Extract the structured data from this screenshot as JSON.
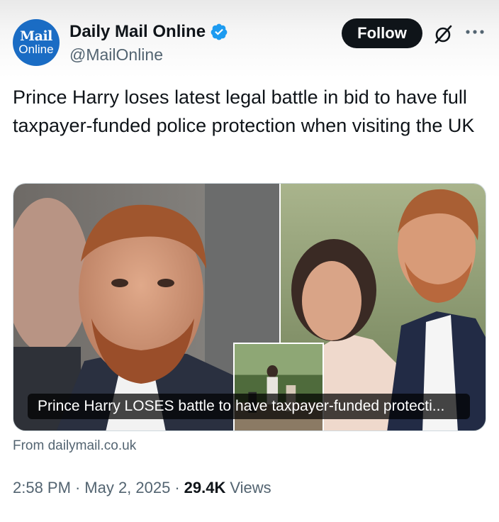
{
  "account": {
    "avatar_line1": "Mail",
    "avatar_line2": "Online",
    "display_name": "Daily Mail Online",
    "handle": "@MailOnline",
    "verified_icon": "verified-badge-icon"
  },
  "actions": {
    "follow_label": "Follow",
    "grok_icon": "grok-icon",
    "more_icon": "more-options-icon"
  },
  "tweet": {
    "text": "Prince Harry loses latest legal battle in bid to have full taxpayer-funded police protection when visiting the UK"
  },
  "card": {
    "caption": "Prince Harry LOSES battle to have taxpayer-funded protecti...",
    "source": "From dailymail.co.uk"
  },
  "meta": {
    "time": "2:58 PM",
    "sep1": "·",
    "date": "May 2, 2025",
    "sep2": "·",
    "views_count": "29.4K",
    "views_label": "Views"
  },
  "colors": {
    "avatar_bg": "#1a6cc4",
    "verified_blue": "#1d9bf0",
    "follow_bg": "#0f1419",
    "secondary_text": "#536471"
  }
}
